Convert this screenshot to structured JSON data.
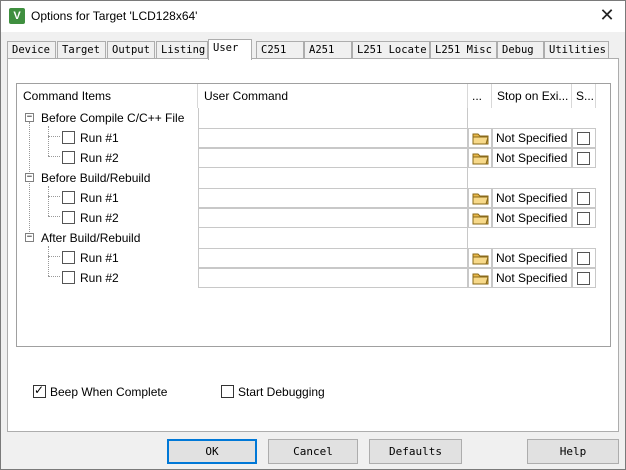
{
  "window": {
    "title": "Options for Target 'LCD128x64'",
    "close_glyph": "✕",
    "app_icon_glyph": "V"
  },
  "tabs": [
    {
      "label": "Device"
    },
    {
      "label": "Target"
    },
    {
      "label": "Output"
    },
    {
      "label": "Listing"
    },
    {
      "label": "User",
      "active": true
    },
    {
      "label": "C251"
    },
    {
      "label": "A251"
    },
    {
      "label": "L251 Locate"
    },
    {
      "label": "L251 Misc"
    },
    {
      "label": "Debug"
    },
    {
      "label": "Utilities"
    }
  ],
  "grid": {
    "headers": {
      "items": "Command Items",
      "command": "User Command",
      "browse": "...",
      "stop": "Stop on Exi...",
      "s": "S..."
    },
    "groups": [
      {
        "label": "Before Compile C/C++ File",
        "expander": "−",
        "runs": [
          {
            "label": "Run #1",
            "command": "",
            "stop": "Not Specified"
          },
          {
            "label": "Run #2",
            "command": "",
            "stop": "Not Specified"
          }
        ]
      },
      {
        "label": "Before Build/Rebuild",
        "expander": "−",
        "runs": [
          {
            "label": "Run #1",
            "command": "",
            "stop": "Not Specified"
          },
          {
            "label": "Run #2",
            "command": "",
            "stop": "Not Specified"
          }
        ]
      },
      {
        "label": "After Build/Rebuild",
        "expander": "−",
        "runs": [
          {
            "label": "Run #1",
            "command": "",
            "stop": "Not Specified"
          },
          {
            "label": "Run #2",
            "command": "",
            "stop": "Not Specified"
          }
        ]
      }
    ]
  },
  "options": {
    "beep": {
      "label": "Beep When Complete",
      "checked": true,
      "check_glyph": "✓"
    },
    "start_debug": {
      "label": "Start Debugging",
      "checked": false
    }
  },
  "buttons": {
    "ok": "OK",
    "cancel": "Cancel",
    "defaults": "Defaults",
    "help": "Help"
  },
  "colors": {
    "accent": "#0078d7",
    "folder": "#e8b84a"
  }
}
